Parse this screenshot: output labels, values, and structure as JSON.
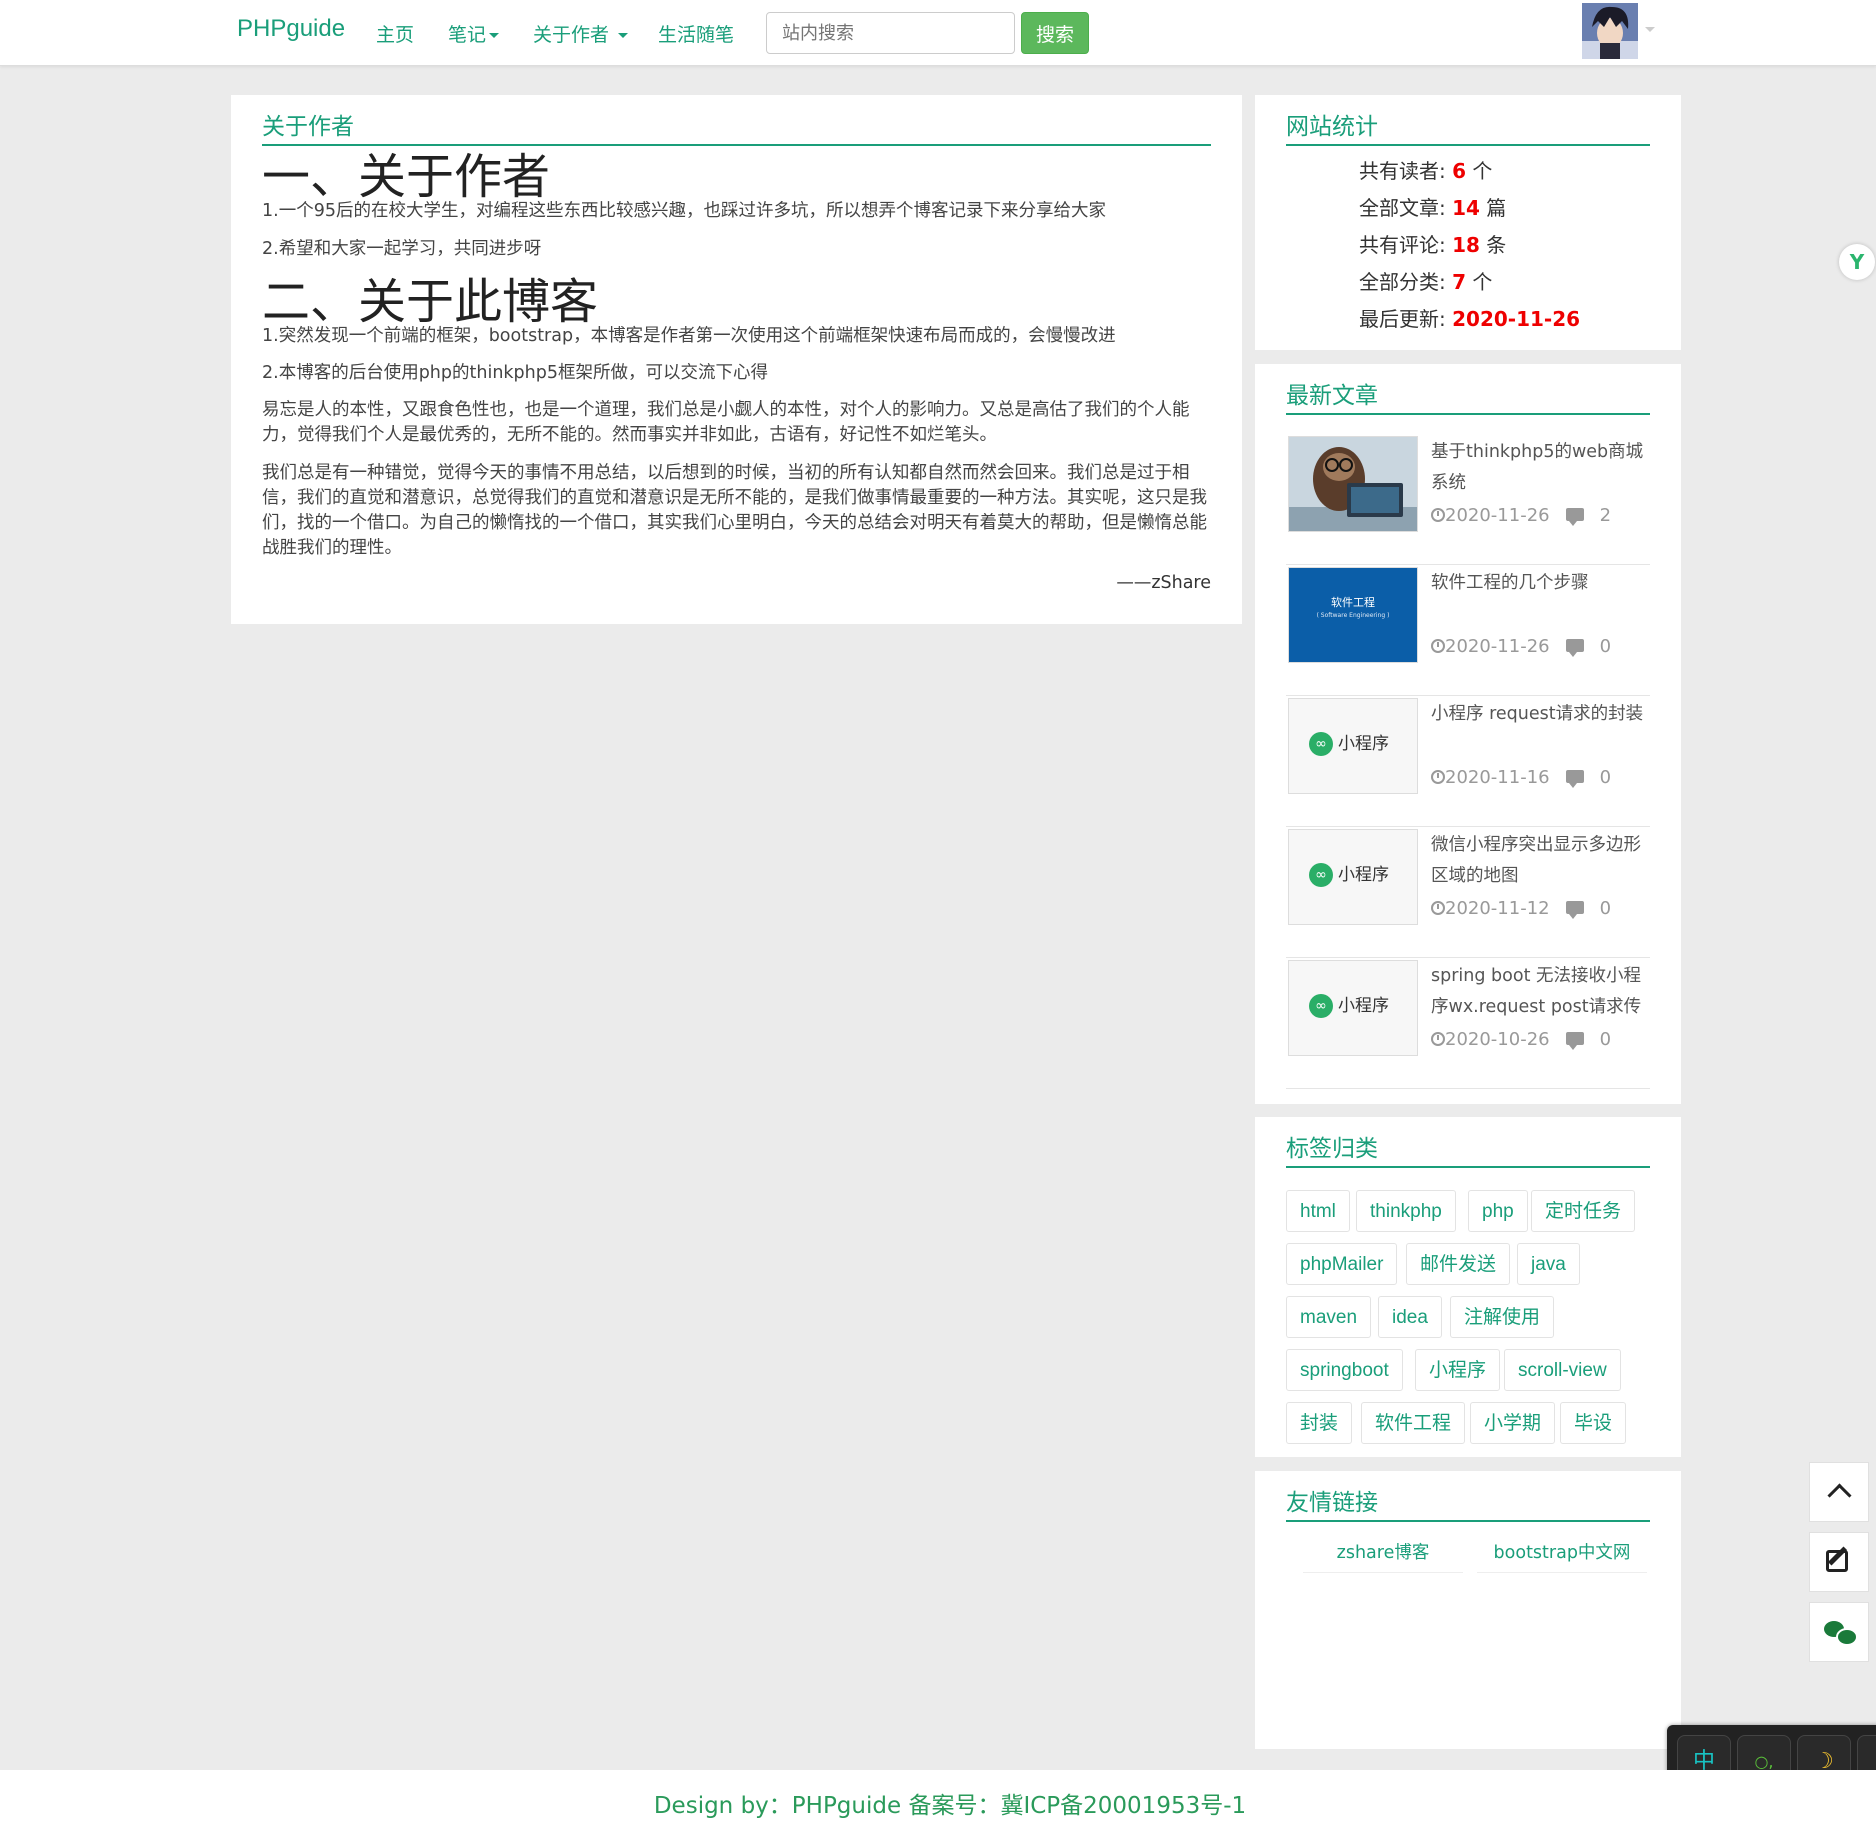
{
  "navbar": {
    "brand": "PHPguide",
    "items": [
      {
        "label": "主页"
      },
      {
        "label": "笔记"
      },
      {
        "label": "关于作者"
      },
      {
        "label": "生活随笔"
      }
    ],
    "search_placeholder": "站内搜索",
    "search_button": "搜索"
  },
  "main": {
    "panel_title": "关于作者",
    "h1_author": "一、关于作者",
    "p1": "1.一个95后的在校大学生，对编程这些东西比较感兴趣，也踩过许多坑，所以想弄个博客记录下来分享给大家",
    "p2": "2.希望和大家一起学习，共同进步呀",
    "h1_blog": "二、关于此博客",
    "p3": "1.突然发现一个前端的框架，bootstrap，本博客是作者第一次使用这个前端框架快速布局而成的，会慢慢改进",
    "p4": "2.本博客的后台使用php的thinkphp5框架所做，可以交流下心得",
    "p5": "易忘是人的本性，又跟食色性也，也是一个道理，我们总是小觑人的本性，对个人的影响力。又总是高估了我们的个人能力，觉得我们个人是最优秀的，无所不能的。然而事实并非如此，古语有，好记性不如烂笔头。",
    "p6": "我们总是有一种错觉，觉得今天的事情不用总结，以后想到的时候，当初的所有认知都自然而然会回来。我们总是过于相信，我们的直觉和潜意识，总觉得我们的直觉和潜意识是无所不能的，是我们做事情最重要的一种方法。其实呢，这只是我们，找的一个借口。为自己的懒惰找的一个借口，其实我们心里明白，今天的总结会对明天有着莫大的帮助，但是懒惰总能战胜我们的理性。",
    "signature": "——zShare"
  },
  "stats": {
    "title": "网站统计",
    "readers_label": "共有读者: ",
    "readers_value": "6",
    "readers_unit": " 个",
    "articles_label": "全部文章: ",
    "articles_value": "14",
    "articles_unit": " 篇",
    "comments_label": "共有评论: ",
    "comments_value": "18",
    "comments_unit": " 条",
    "categories_label": "全部分类: ",
    "categories_value": "7",
    "categories_unit": " 个",
    "updated_label": "最后更新: ",
    "updated_value": "2020-11-26"
  },
  "latest": {
    "title": "最新文章",
    "articles": [
      {
        "title": "基于thinkphp5的web商城系统",
        "date": "2020-11-26",
        "comments": "2"
      },
      {
        "title": "软件工程的几个步骤",
        "date": "2020-11-26",
        "comments": "0",
        "thumb_title": "软件工程",
        "thumb_sub": "( Software Engineering )"
      },
      {
        "title": "小程序 request请求的封装",
        "date": "2020-11-16",
        "comments": "0",
        "thumb_label": "小程序"
      },
      {
        "title": "微信小程序突出显示多边形区域的地图",
        "date": "2020-11-12",
        "comments": "0",
        "thumb_label": "小程序"
      },
      {
        "title": "spring boot 无法接收小程序wx.request post请求传递的",
        "date": "2020-10-26",
        "comments": "0",
        "thumb_label": "小程序"
      }
    ]
  },
  "tags": {
    "title": "标签归类",
    "items": [
      "html",
      "thinkphp",
      "php",
      "定时任务",
      "phpMailer",
      "邮件发送",
      "java",
      "maven",
      "idea",
      "注解使用",
      "springboot",
      "小程序",
      "scroll-view",
      "封装",
      "软件工程",
      "小学期",
      "毕设"
    ]
  },
  "friends": {
    "title": "友情链接",
    "items": [
      "zshare博客",
      "bootstrap中文网"
    ]
  },
  "ime": {
    "lang": "中",
    "punct": "○,",
    "moon": "☽"
  },
  "footer": {
    "text": "Design by：PHPguide 备案号：冀ICP备20001953号-1"
  },
  "colors": {
    "accent": "#1a9e7a",
    "search_button": "#5cb85c",
    "stat_value": "#ee0000",
    "background": "#ebebeb"
  }
}
